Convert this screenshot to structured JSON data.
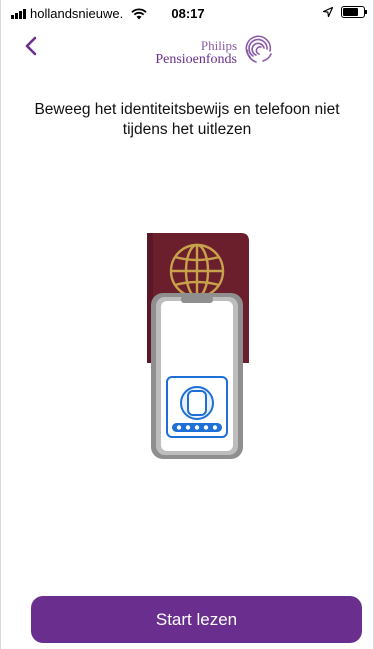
{
  "status_bar": {
    "carrier": "hollandsnieuwe.",
    "time": "08:17",
    "battery_level": 0.85
  },
  "header": {
    "back_icon": "chevron-left-icon",
    "logo_top": "Philips",
    "logo_bottom": "Pensioenfonds",
    "logo_icon": "fingerprint-icon"
  },
  "main": {
    "instruction": "Beweeg het identiteitsbewijs en telefoon niet tijdens het uitlezen",
    "illustration_icons": [
      "passport-icon",
      "phone-icon",
      "nfc-chip-icon"
    ]
  },
  "actions": {
    "start_label": "Start lezen"
  },
  "colors": {
    "brand": "#6a2f8e",
    "passport": "#6b1f2d",
    "passport_emblem": "#c8a24a",
    "phone_frame": "#8f8f8f",
    "chip_blue": "#1e6fd6"
  }
}
